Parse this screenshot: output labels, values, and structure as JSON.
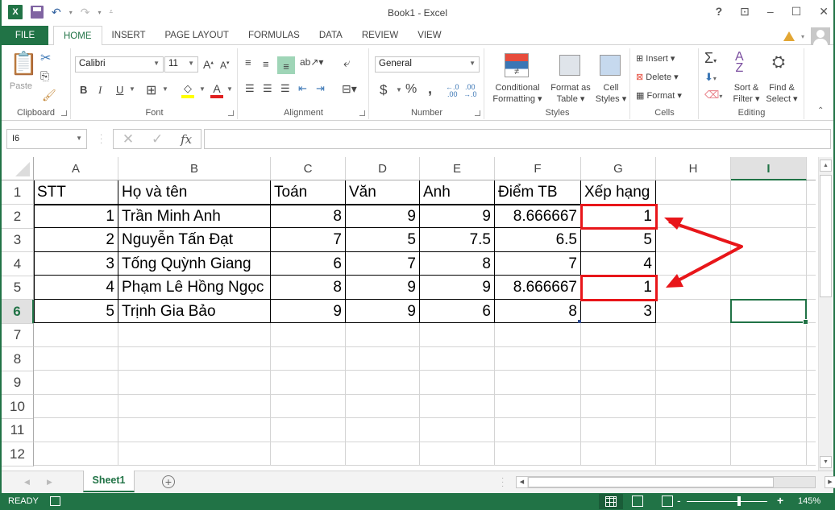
{
  "app": {
    "title": "Book1 - Excel",
    "logo_text": "X",
    "window_controls": [
      "?",
      "ribbon-display-options",
      "minimize",
      "maximize",
      "close"
    ]
  },
  "tabs": [
    {
      "label": "FILE"
    },
    {
      "label": "HOME",
      "active": true
    },
    {
      "label": "INSERT"
    },
    {
      "label": "PAGE LAYOUT"
    },
    {
      "label": "FORMULAS"
    },
    {
      "label": "DATA"
    },
    {
      "label": "REVIEW"
    },
    {
      "label": "VIEW"
    }
  ],
  "ribbon": {
    "clipboard": {
      "label": "Clipboard",
      "paste": "Paste"
    },
    "font": {
      "label": "Font",
      "font_name": "Calibri",
      "font_size": "11",
      "bold": "B",
      "italic": "I",
      "underline": "U"
    },
    "alignment": {
      "label": "Alignment"
    },
    "number": {
      "label": "Number",
      "format": "General",
      "currency": "$",
      "percent": "%",
      "comma": ","
    },
    "styles": {
      "label": "Styles",
      "conditional": "Conditional",
      "conditional2": "Formatting",
      "format_table": "Format as",
      "format_table2": "Table",
      "cell_styles": "Cell",
      "cell_styles2": "Styles"
    },
    "cells": {
      "label": "Cells",
      "insert": "Insert",
      "delete": "Delete",
      "format": "Format"
    },
    "editing": {
      "label": "Editing",
      "sort": "Sort &",
      "sort2": "Filter",
      "find": "Find &",
      "find2": "Select"
    }
  },
  "formula_bar": {
    "name_box": "I6",
    "formula": "",
    "fx": "fx"
  },
  "sheet": {
    "columns": [
      "A",
      "B",
      "C",
      "D",
      "E",
      "F",
      "G",
      "H",
      "I"
    ],
    "selected_column": "I",
    "rows": [
      "1",
      "2",
      "3",
      "4",
      "5",
      "6",
      "7",
      "8",
      "9",
      "10",
      "11",
      "12"
    ],
    "selected_row": "6",
    "selected_cell": "I6",
    "header": [
      "STT",
      "Họ và tên",
      "Toán",
      "Văn",
      "Anh",
      "Điểm TB",
      "Xếp hạng"
    ],
    "data": [
      [
        "1",
        "Trần Minh Anh",
        "8",
        "9",
        "9",
        "8.666667",
        "1"
      ],
      [
        "2",
        "Nguyễn Tấn Đạt",
        "7",
        "5",
        "7.5",
        "6.5",
        "5"
      ],
      [
        "3",
        "Tống Quỳnh Giang",
        "6",
        "7",
        "8",
        "7",
        "4"
      ],
      [
        "4",
        "Phạm Lê Hồng Ngọc",
        "8",
        "9",
        "9",
        "8.666667",
        "1"
      ],
      [
        "5",
        "Trịnh Gia Bảo",
        "9",
        "9",
        "6",
        "8",
        "3"
      ]
    ],
    "highlighted_cells": [
      "G2",
      "G5"
    ],
    "highlight_color": "#e8161a"
  },
  "sheet_tabs": [
    {
      "label": "Sheet1",
      "active": true
    }
  ],
  "status": {
    "mode": "READY",
    "zoom": "145%",
    "zoom_minus": "-",
    "zoom_plus": "+"
  },
  "colors": {
    "accent": "#217346",
    "annotation": "#e8161a"
  }
}
